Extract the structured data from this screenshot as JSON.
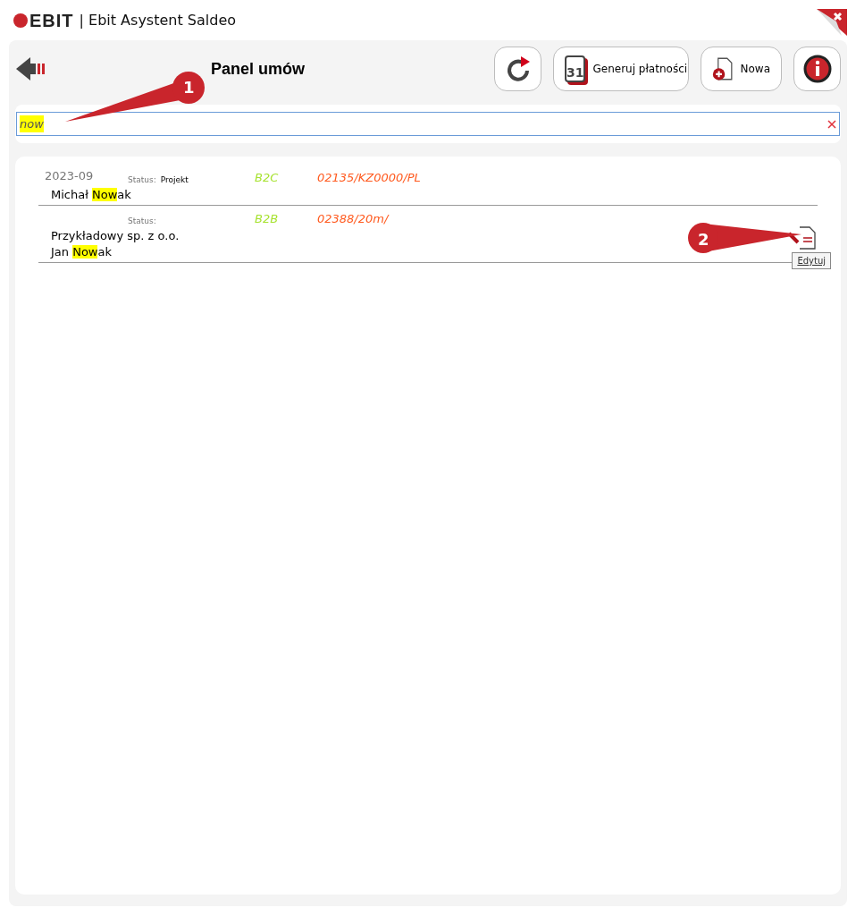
{
  "window": {
    "logo": "EBIT",
    "title": "| Ebit Asystent Saldeo"
  },
  "header": {
    "title": "Panel umów",
    "buttons": [
      {
        "kind": "refresh"
      },
      {
        "kind": "calendar",
        "label": "Generuj płatności",
        "icon_text": "31"
      },
      {
        "kind": "new",
        "label": "Nowa"
      },
      {
        "kind": "info"
      }
    ]
  },
  "search": {
    "value": "now",
    "highlighted": true
  },
  "rows": [
    {
      "date": "2023-09",
      "status_label": "Status:",
      "status": "Projekt",
      "type": "B2C",
      "number": "02135/KZ0000/PL",
      "lines": [
        [
          {
            "text": "Michał ",
            "highlighted": false
          },
          {
            "text": "Now",
            "highlighted": true
          },
          {
            "text": "ak",
            "highlighted": false
          }
        ]
      ],
      "edit_tooltip": null
    },
    {
      "status_label": "Status:",
      "type": "B2B",
      "number": "02388/20m/",
      "lines": [
        [
          {
            "text": "Przykładowy sp. z o.o.",
            "highlighted": false
          }
        ],
        [
          {
            "text": "Jan ",
            "highlighted": false
          },
          {
            "text": "Now",
            "highlighted": true
          },
          {
            "text": "ak",
            "highlighted": false
          }
        ]
      ],
      "edit_tooltip": "Edytuj"
    }
  ],
  "callouts": [
    {
      "number": "1"
    },
    {
      "number": "2"
    }
  ]
}
